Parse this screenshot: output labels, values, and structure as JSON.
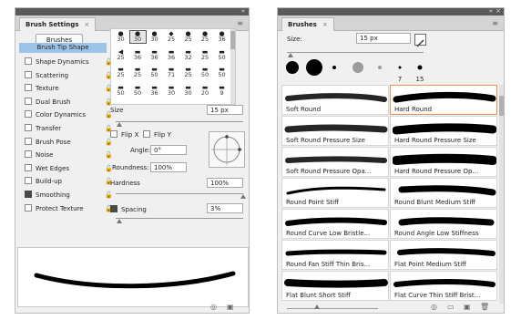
{
  "brush_settings": {
    "tab_label": "Brush Settings",
    "close_glyph": "×",
    "brushes_button": "Brushes",
    "brush_tip_shape": "Brush Tip Shape",
    "options": [
      {
        "label": "Shape Dynamics",
        "checked": false
      },
      {
        "label": "Scattering",
        "checked": false
      },
      {
        "label": "Texture",
        "checked": false
      },
      {
        "label": "Dual Brush",
        "checked": false
      },
      {
        "label": "Color Dynamics",
        "checked": false
      },
      {
        "label": "Transfer",
        "checked": false
      },
      {
        "label": "Brush Pose",
        "checked": false
      },
      {
        "label": "Noise",
        "checked": false
      },
      {
        "label": "Wet Edges",
        "checked": false
      },
      {
        "label": "Build-up",
        "checked": false
      },
      {
        "label": "Smoothing",
        "checked": true
      },
      {
        "label": "Protect Texture",
        "checked": false
      }
    ],
    "tip_rows": [
      [
        "30",
        "30",
        "30",
        "25",
        "25",
        "25",
        "36"
      ],
      [
        "25",
        "36",
        "36",
        "36",
        "32",
        "25",
        "50"
      ],
      [
        "25",
        "25",
        "50",
        "71",
        "25",
        "50",
        "50"
      ],
      [
        "50",
        "50",
        "36",
        "30",
        "30",
        "20",
        "9"
      ]
    ],
    "size_label": "Size",
    "size_value": "15 px",
    "flip_x": "Flip X",
    "flip_y": "Flip Y",
    "angle_label": "Angle:",
    "angle_value": "0°",
    "roundness_label": "Roundness:",
    "roundness_value": "100%",
    "hardness_label": "Hardness",
    "hardness_value": "100%",
    "spacing_label": "Spacing",
    "spacing_value": "3%",
    "spacing_checked": true
  },
  "brushes_panel": {
    "tab_label": "Brushes",
    "close_glyph": "×",
    "size_label": "Size:",
    "size_value": "15 px",
    "recent_presets": [
      {
        "label": ""
      },
      {
        "label": ""
      },
      {
        "label": ""
      },
      {
        "label": ""
      },
      {
        "label": ""
      },
      {
        "label": "7"
      },
      {
        "label": "15"
      }
    ],
    "presets": [
      {
        "name": "Soft Round",
        "highlight": false
      },
      {
        "name": "Hard Round",
        "highlight": true
      },
      {
        "name": "Soft Round Pressure Size",
        "highlight": false
      },
      {
        "name": "Hard Round Pressure Size",
        "highlight": false
      },
      {
        "name": "Soft Round Pressure Opa...",
        "highlight": false
      },
      {
        "name": "Hard Round Pressure Op...",
        "highlight": false
      },
      {
        "name": "Round Point Stiff",
        "highlight": false
      },
      {
        "name": "Round Blunt Medium Stiff",
        "highlight": false
      },
      {
        "name": "Round Curve Low Bristle...",
        "highlight": false
      },
      {
        "name": "Round Angle Low Stiffness",
        "highlight": false
      },
      {
        "name": "Round Fan Stiff Thin Bris...",
        "highlight": false
      },
      {
        "name": "Flat Point Medium Stiff",
        "highlight": false
      },
      {
        "name": "Flat Blunt Short Stiff",
        "highlight": false
      },
      {
        "name": "Flat Curve Thin Stiff Brist...",
        "highlight": false
      }
    ]
  },
  "colors": {
    "selected_item": "#9cc4e8",
    "highlight_border": "#e8935a",
    "panel_bg": "#f0f0f0"
  }
}
